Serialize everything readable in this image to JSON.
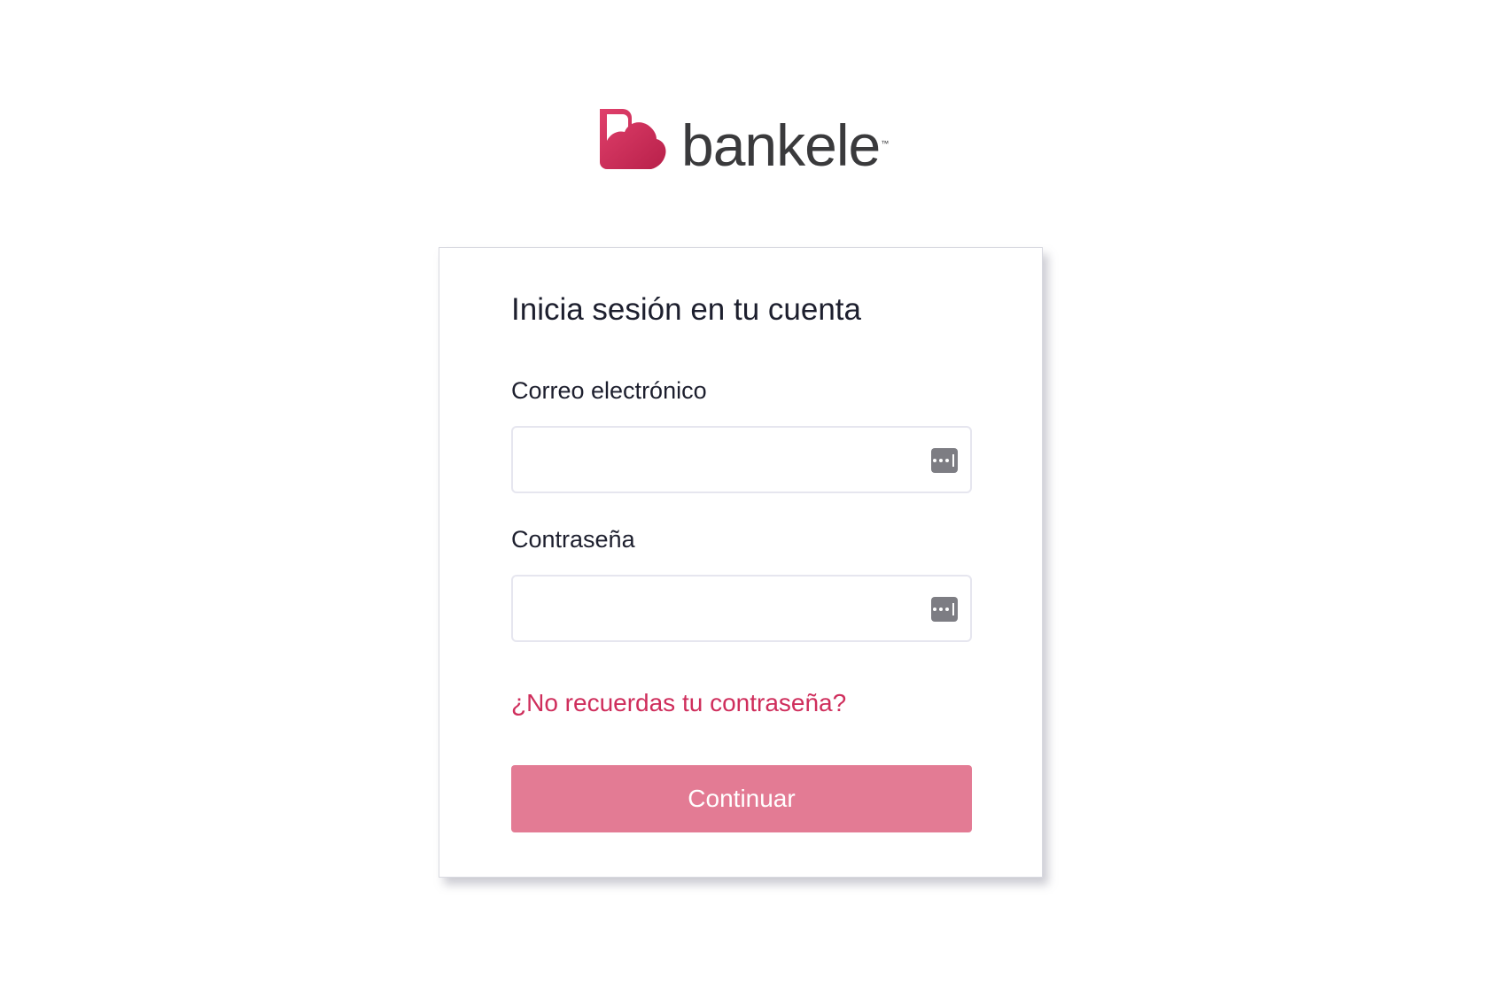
{
  "brand": {
    "name": "bankele",
    "trademark": "™",
    "logo_icon": "bankele-logo-icon",
    "logo_color": "#cf2e5c",
    "wordmark_color": "#3a3a3c"
  },
  "login": {
    "title": "Inicia sesión en tu cuenta",
    "email": {
      "label": "Correo electrónico",
      "value": "",
      "placeholder": "",
      "icon": "password-manager-icon"
    },
    "password": {
      "label": "Contraseña",
      "value": "",
      "placeholder": "",
      "icon": "password-manager-icon"
    },
    "forgot_password_link": "¿No recuerdas tu contraseña?",
    "continue_button": "Continuar"
  },
  "colors": {
    "accent": "#cf2e5c",
    "button_background": "#e37b94",
    "text": "#1d1f2e"
  }
}
